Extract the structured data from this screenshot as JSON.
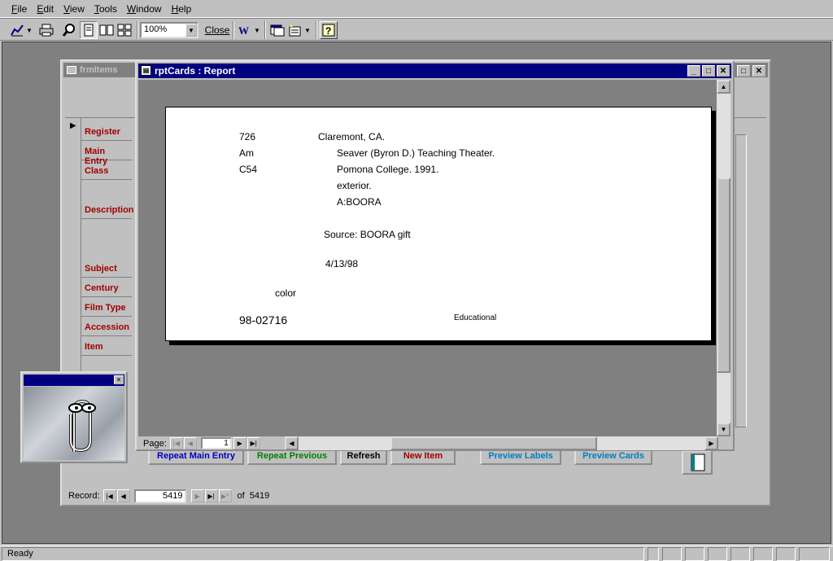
{
  "menu": {
    "items": [
      {
        "label": "File",
        "key": "F",
        "rest": "ile"
      },
      {
        "label": "Edit",
        "key": "E",
        "rest": "dit"
      },
      {
        "label": "View",
        "key": "V",
        "rest": "iew"
      },
      {
        "label": "Tools",
        "key": "T",
        "rest": "ools"
      },
      {
        "label": "Window",
        "key": "W",
        "rest": "indow"
      },
      {
        "label": "Help",
        "key": "H",
        "rest": "elp"
      }
    ]
  },
  "toolbar": {
    "zoom_value": "100%",
    "close_label": "Close"
  },
  "form": {
    "title": "frmItems",
    "fields": [
      "Register",
      "Main Entry",
      "Class",
      "Description",
      "Subject",
      "Century",
      "Film Type",
      "Accession",
      "Item"
    ],
    "buttons": {
      "repeat_main_entry": "Repeat Main Entry",
      "repeat_previous": "Repeat Previous",
      "refresh": "Refresh",
      "new_item": "New Item",
      "preview_labels": "Preview Labels",
      "preview_cards": "Preview Cards"
    },
    "record_nav": {
      "label": "Record:",
      "current": "5419",
      "of_label": "of",
      "total": "5419"
    }
  },
  "report": {
    "title": "rptCards : Report",
    "card": {
      "call1": "726",
      "call2": "Am",
      "call3": "C54",
      "place": "Claremont, CA.",
      "line1": "Seaver (Byron D.) Teaching Theater.",
      "line2": "Pomona College. 1991.",
      "line3": "exterior.",
      "line4": "A:BOORA",
      "source": "Source: BOORA gift",
      "date": "4/13/98",
      "color": "color",
      "accession": "98-02716",
      "category": "Educational"
    },
    "page_nav": {
      "label": "Page:",
      "current": "1"
    }
  },
  "status": {
    "text": "Ready"
  },
  "colors": {
    "active_title": "#000080",
    "inactive_title": "#808080",
    "field_label": "#a00000",
    "face": "#c0c0c0"
  }
}
